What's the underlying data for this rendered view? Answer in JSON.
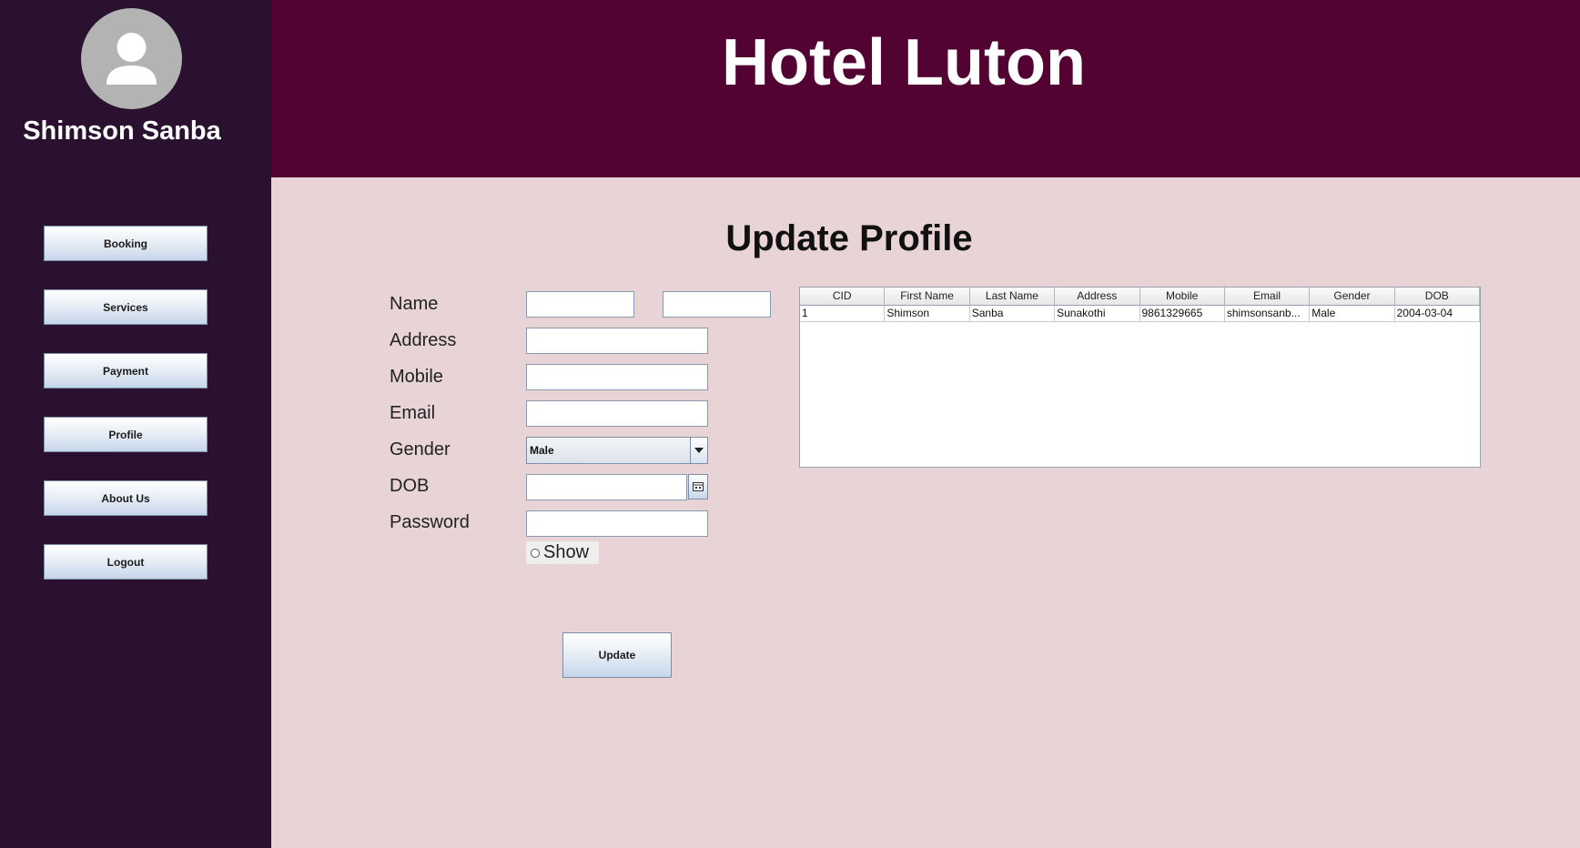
{
  "app": {
    "hotel_name": "Hotel Luton"
  },
  "sidebar": {
    "user_name": "Shimson Sanba",
    "avatar_icon": "user-avatar-icon",
    "nav": [
      {
        "label": "Booking"
      },
      {
        "label": "Services"
      },
      {
        "label": "Payment"
      },
      {
        "label": "Profile"
      },
      {
        "label": "About Us"
      },
      {
        "label": "Logout"
      }
    ]
  },
  "page": {
    "title": "Update Profile"
  },
  "form": {
    "name_label": "Name",
    "first_name_value": "",
    "last_name_value": "",
    "address_label": "Address",
    "address_value": "",
    "mobile_label": "Mobile",
    "mobile_value": "",
    "email_label": "Email",
    "email_value": "",
    "gender_label": "Gender",
    "gender_selected": "Male",
    "dob_label": "DOB",
    "dob_value": "",
    "password_label": "Password",
    "password_value": "",
    "show_label": "Show",
    "show_checked": false,
    "update_label": "Update"
  },
  "table": {
    "columns": [
      "CID",
      "First Name",
      "Last Name",
      "Address",
      "Mobile",
      "Email",
      "Gender",
      "DOB"
    ],
    "rows": [
      [
        "1",
        "Shimson",
        "Sanba",
        "Sunakothi",
        "9861329665",
        "shimsonsanb...",
        "Male",
        "2004-03-04"
      ]
    ]
  },
  "colors": {
    "sidebar_bg": "#2a1130",
    "header_bg": "#530332",
    "content_bg": "#e8d4d7"
  }
}
